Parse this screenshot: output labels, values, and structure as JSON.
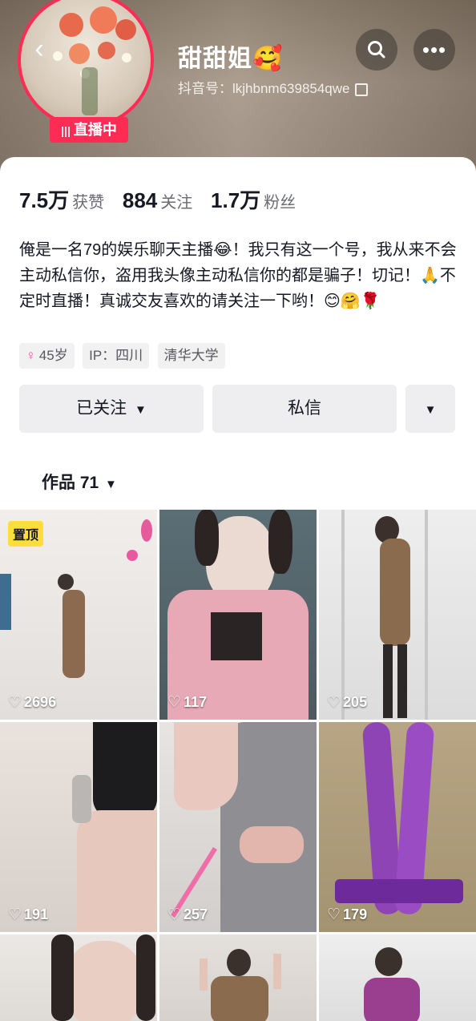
{
  "header": {
    "back_icon": "chevron-left-icon",
    "nickname": "甜甜姐🥰",
    "douyin_id": "抖音号：lkjhbnm639854qwe",
    "live_badge": "直播中",
    "search_icon": "search-icon",
    "more_icon": "more-icon"
  },
  "stats": [
    {
      "num": "7.5万",
      "label": "获赞"
    },
    {
      "num": "884",
      "label": "关注"
    },
    {
      "num": "1.7万",
      "label": "粉丝"
    }
  ],
  "bio": "俺是一名79的娱乐聊天主播😂！我只有这一个号，我从来不会主动私信你，盗用我头像主动私信你的都是骗子！切记！🙏不定时直播！真诚交友喜欢的请关注一下哟！😊🤗🌹",
  "tags": {
    "age": "45岁",
    "ip": "IP：四川",
    "school": "清华大学"
  },
  "buttons": {
    "follow": "已关注",
    "message": "私信"
  },
  "works_tab": "作品 71",
  "videos": [
    {
      "likes": "2696",
      "pinned": "置顶"
    },
    {
      "likes": "117"
    },
    {
      "likes": "205"
    },
    {
      "likes": "191"
    },
    {
      "likes": "257"
    },
    {
      "likes": "179"
    }
  ],
  "colors": {
    "accent": "#fe2c55",
    "pin": "#ffde3c"
  }
}
